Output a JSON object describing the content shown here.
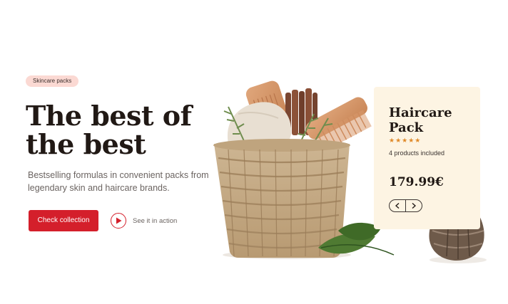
{
  "hero": {
    "badge": "Skincare packs",
    "title": "The best of the best",
    "subtitle": "Bestselling formulas in convenient packs from legendary skin and haircare brands.",
    "cta_label": "Check collection",
    "video_label": "See it in action"
  },
  "product_card": {
    "title": "Haircare Pack",
    "rating": 5,
    "stars": "★★★★★",
    "products_included": "4 products included",
    "price": "179.99€"
  },
  "colors": {
    "accent": "#d41f2b",
    "badge_bg": "#fbd9d3",
    "card_bg": "#fdf4e3",
    "star": "#e08a2a"
  },
  "icons": [
    "play-icon",
    "chevron-left-icon",
    "chevron-right-icon"
  ]
}
